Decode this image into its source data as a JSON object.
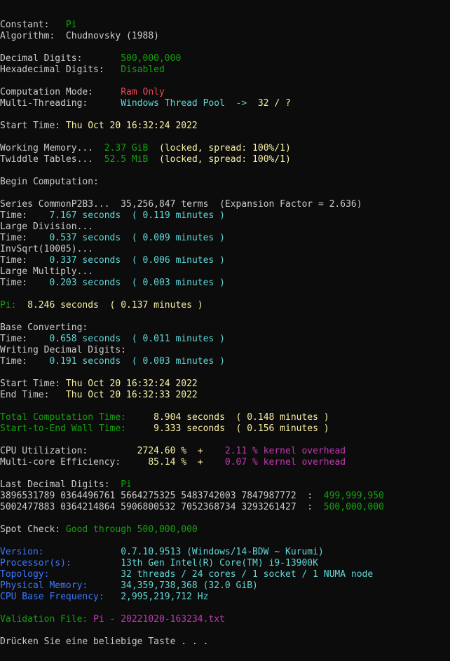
{
  "colors": {
    "background": "#0c0c0c",
    "default_text": "#cccccc",
    "green": "#13a10e",
    "red": "#e74856",
    "cyan": "#61d6d6",
    "light_yellow": "#f9f1a5",
    "blue": "#3b78ff",
    "magenta": "#c239b3"
  },
  "lines": [
    {
      "name": "constant-line",
      "segs": [
        {
          "t": "Constant:   ",
          "c": "w"
        },
        {
          "t": "Pi",
          "c": "g"
        }
      ]
    },
    {
      "name": "algorithm-line",
      "segs": [
        {
          "t": "Algorithm:  Chudnovsky (1988)",
          "c": "w"
        }
      ]
    },
    {
      "blank": true
    },
    {
      "name": "decimal-digits-line",
      "segs": [
        {
          "t": "Decimal Digits:       ",
          "c": "w"
        },
        {
          "t": "500,000,000",
          "c": "g"
        }
      ]
    },
    {
      "name": "hexadecimal-digits-line",
      "segs": [
        {
          "t": "Hexadecimal Digits:   ",
          "c": "w"
        },
        {
          "t": "Disabled",
          "c": "g"
        }
      ]
    },
    {
      "blank": true
    },
    {
      "name": "computation-mode-line",
      "segs": [
        {
          "t": "Computation Mode:     ",
          "c": "w"
        },
        {
          "t": "Ram Only",
          "c": "r"
        }
      ]
    },
    {
      "name": "multi-threading-line",
      "segs": [
        {
          "t": "Multi-Threading:      ",
          "c": "w"
        },
        {
          "t": "Windows Thread Pool  ->  ",
          "c": "c"
        },
        {
          "t": "32 / ?",
          "c": "y"
        }
      ]
    },
    {
      "blank": true
    },
    {
      "name": "start-time-line",
      "segs": [
        {
          "t": "Start Time: ",
          "c": "w"
        },
        {
          "t": "Thu Oct 20 16:32:24 2022",
          "c": "y"
        }
      ]
    },
    {
      "blank": true
    },
    {
      "name": "working-memory-line",
      "segs": [
        {
          "t": "Working Memory...  ",
          "c": "w"
        },
        {
          "t": "2.37 GiB",
          "c": "g"
        },
        {
          "t": "  (locked, spread: 100%/1)",
          "c": "y"
        }
      ]
    },
    {
      "name": "twiddle-tables-line",
      "segs": [
        {
          "t": "Twiddle Tables...  ",
          "c": "w"
        },
        {
          "t": "52.5 MiB",
          "c": "g"
        },
        {
          "t": "  (locked, spread: 100%/1)",
          "c": "y"
        }
      ]
    },
    {
      "blank": true
    },
    {
      "name": "begin-computation-line",
      "segs": [
        {
          "t": "Begin Computation:",
          "c": "w"
        }
      ]
    },
    {
      "blank": true
    },
    {
      "name": "series-line",
      "segs": [
        {
          "t": "Series CommonP2B3...  35,256,847 terms  (Expansion Factor = 2.636)",
          "c": "w"
        }
      ]
    },
    {
      "name": "series-time-line",
      "segs": [
        {
          "t": "Time:    ",
          "c": "w"
        },
        {
          "t": "7.167 seconds  ( 0.119 minutes )",
          "c": "c"
        }
      ]
    },
    {
      "name": "large-division-line",
      "segs": [
        {
          "t": "Large Division...",
          "c": "w"
        }
      ]
    },
    {
      "name": "large-division-time-line",
      "segs": [
        {
          "t": "Time:    ",
          "c": "w"
        },
        {
          "t": "0.537 seconds  ( 0.009 minutes )",
          "c": "c"
        }
      ]
    },
    {
      "name": "invsqrt-line",
      "segs": [
        {
          "t": "InvSqrt(10005)...",
          "c": "w"
        }
      ]
    },
    {
      "name": "invsqrt-time-line",
      "segs": [
        {
          "t": "Time:    ",
          "c": "w"
        },
        {
          "t": "0.337 seconds  ( 0.006 minutes )",
          "c": "c"
        }
      ]
    },
    {
      "name": "large-multiply-line",
      "segs": [
        {
          "t": "Large Multiply...",
          "c": "w"
        }
      ]
    },
    {
      "name": "large-multiply-time-line",
      "segs": [
        {
          "t": "Time:    ",
          "c": "w"
        },
        {
          "t": "0.203 seconds  ( 0.003 minutes )",
          "c": "c"
        }
      ]
    },
    {
      "blank": true
    },
    {
      "name": "pi-time-line",
      "segs": [
        {
          "t": "Pi:  ",
          "c": "g"
        },
        {
          "t": "8.246 seconds  ( 0.137 minutes )",
          "c": "y"
        }
      ]
    },
    {
      "blank": true
    },
    {
      "name": "base-converting-line",
      "segs": [
        {
          "t": "Base Converting:",
          "c": "w"
        }
      ]
    },
    {
      "name": "base-converting-time-line",
      "segs": [
        {
          "t": "Time:    ",
          "c": "w"
        },
        {
          "t": "0.658 seconds  ( 0.011 minutes )",
          "c": "c"
        }
      ]
    },
    {
      "name": "writing-digits-line",
      "segs": [
        {
          "t": "Writing Decimal Digits:",
          "c": "w"
        }
      ]
    },
    {
      "name": "writing-digits-time-line",
      "segs": [
        {
          "t": "Time:    ",
          "c": "w"
        },
        {
          "t": "0.191 seconds  ( 0.003 minutes )",
          "c": "c"
        }
      ]
    },
    {
      "blank": true
    },
    {
      "name": "start-time-summary-line",
      "segs": [
        {
          "t": "Start Time: ",
          "c": "w"
        },
        {
          "t": "Thu Oct 20 16:32:24 2022",
          "c": "y"
        }
      ]
    },
    {
      "name": "end-time-line",
      "segs": [
        {
          "t": "End Time:   ",
          "c": "w"
        },
        {
          "t": "Thu Oct 20 16:32:33 2022",
          "c": "y"
        }
      ]
    },
    {
      "blank": true
    },
    {
      "name": "total-computation-time-line",
      "segs": [
        {
          "t": "Total Computation Time:     ",
          "c": "g"
        },
        {
          "t": "8.904 seconds  ( 0.148 minutes )",
          "c": "y"
        }
      ]
    },
    {
      "name": "wall-time-line",
      "segs": [
        {
          "t": "Start-to-End Wall Time:     ",
          "c": "g"
        },
        {
          "t": "9.333 seconds  ( 0.156 minutes )",
          "c": "y"
        }
      ]
    },
    {
      "blank": true
    },
    {
      "name": "cpu-utilization-line",
      "segs": [
        {
          "t": "CPU Utilization:         ",
          "c": "w"
        },
        {
          "t": "2724.60 %  +    ",
          "c": "y"
        },
        {
          "t": "2.11 % kernel overhead",
          "c": "p"
        }
      ]
    },
    {
      "name": "multi-core-efficiency-line",
      "segs": [
        {
          "t": "Multi-core Efficiency:     ",
          "c": "w"
        },
        {
          "t": "85.14 %  +    ",
          "c": "y"
        },
        {
          "t": "0.07 % kernel overhead",
          "c": "p"
        }
      ]
    },
    {
      "blank": true
    },
    {
      "name": "last-decimal-digits-line",
      "segs": [
        {
          "t": "Last Decimal Digits:  ",
          "c": "w"
        },
        {
          "t": "Pi",
          "c": "g"
        }
      ]
    },
    {
      "name": "digits-row-1",
      "segs": [
        {
          "t": "3896531789 0364496761 5664275325 5483742003 7847987772  :  ",
          "c": "w"
        },
        {
          "t": "499,999,950",
          "c": "g"
        }
      ]
    },
    {
      "name": "digits-row-2",
      "segs": [
        {
          "t": "5002477883 0364214864 5906800532 7052368734 3293261427  :  ",
          "c": "w"
        },
        {
          "t": "500,000,000",
          "c": "g"
        }
      ]
    },
    {
      "blank": true
    },
    {
      "name": "spot-check-line",
      "segs": [
        {
          "t": "Spot Check: ",
          "c": "w"
        },
        {
          "t": "Good through 500,000,000",
          "c": "g"
        }
      ]
    },
    {
      "blank": true
    },
    {
      "name": "version-line",
      "segs": [
        {
          "t": "Version:              ",
          "c": "b"
        },
        {
          "t": "0.7.10.9513 (Windows/14-BDW ~ Kurumi)",
          "c": "c"
        }
      ]
    },
    {
      "name": "processor-line",
      "segs": [
        {
          "t": "Processor(s):         ",
          "c": "b"
        },
        {
          "t": "13th Gen Intel(R) Core(TM) i9-13900K",
          "c": "c"
        }
      ]
    },
    {
      "name": "topology-line",
      "segs": [
        {
          "t": "Topology:             ",
          "c": "b"
        },
        {
          "t": "32 threads / 24 cores / 1 socket / 1 NUMA node",
          "c": "c"
        }
      ]
    },
    {
      "name": "physical-memory-line",
      "segs": [
        {
          "t": "Physical Memory:      ",
          "c": "b"
        },
        {
          "t": "34,359,738,368 (32.0 GiB)",
          "c": "c"
        }
      ]
    },
    {
      "name": "cpu-base-frequency-line",
      "segs": [
        {
          "t": "CPU Base Frequency:   ",
          "c": "b"
        },
        {
          "t": "2,995,219,712 Hz",
          "c": "c"
        }
      ]
    },
    {
      "blank": true
    },
    {
      "name": "validation-file-line",
      "segs": [
        {
          "t": "Validation File: ",
          "c": "g"
        },
        {
          "t": "Pi - 20221020-163234.txt",
          "c": "p"
        }
      ]
    },
    {
      "blank": true
    },
    {
      "name": "press-any-key-line",
      "segs": [
        {
          "t": "Drücken Sie eine beliebige Taste . . .",
          "c": "w"
        }
      ]
    }
  ]
}
